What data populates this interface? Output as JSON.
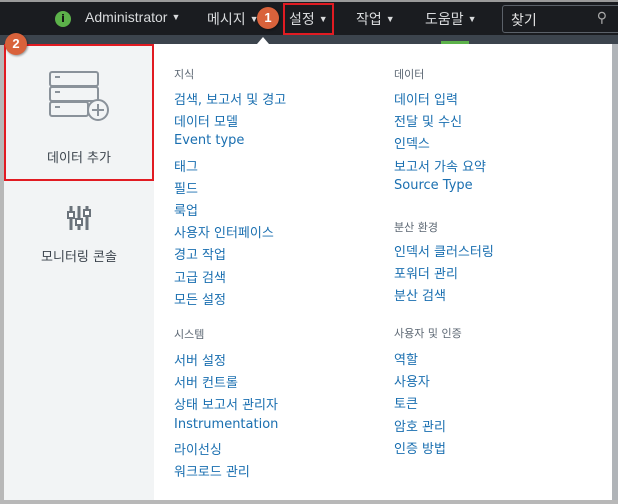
{
  "nav": {
    "admin": "Administrator",
    "messages": "메시지",
    "settings": "설정",
    "activity": "작업",
    "help": "도움말",
    "search_placeholder": "찾기"
  },
  "badges": {
    "one": "1",
    "two": "2"
  },
  "left": {
    "add_data": "데이터 추가",
    "monitoring": "모니터링 콘솔"
  },
  "columns": [
    {
      "sections": [
        {
          "title": "지식",
          "items": [
            "검색, 보고서 및 경고",
            "데이터 모델",
            "Event type",
            "태그",
            "필드",
            "룩업",
            "사용자 인터페이스",
            "경고 작업",
            "고급 검색",
            "모든 설정"
          ]
        },
        {
          "title": "시스템",
          "items": [
            "서버 설정",
            "서버 컨트롤",
            "상태 보고서 관리자",
            "Instrumentation",
            "라이선싱",
            "워크로드 관리"
          ]
        }
      ]
    },
    {
      "sections": [
        {
          "title": "데이터",
          "items": [
            "데이터 입력",
            "전달 및 수신",
            "인덱스",
            "보고서 가속 요약",
            "Source Type"
          ]
        },
        {
          "title": "분산 환경",
          "items": [
            "인덱서 클러스터링",
            "포워더 관리",
            "분산 검색"
          ]
        },
        {
          "title": "사용자 및 인증",
          "items": [
            "역할",
            "사용자",
            "토큰",
            "암호 관리",
            "인증 방법"
          ]
        }
      ]
    }
  ],
  "colors": {
    "nav_bg": "#1a1c20",
    "link": "#1a6fb0",
    "highlight": "#e11b22",
    "badge": "#d9623b",
    "status_green": "#5cb24a"
  }
}
